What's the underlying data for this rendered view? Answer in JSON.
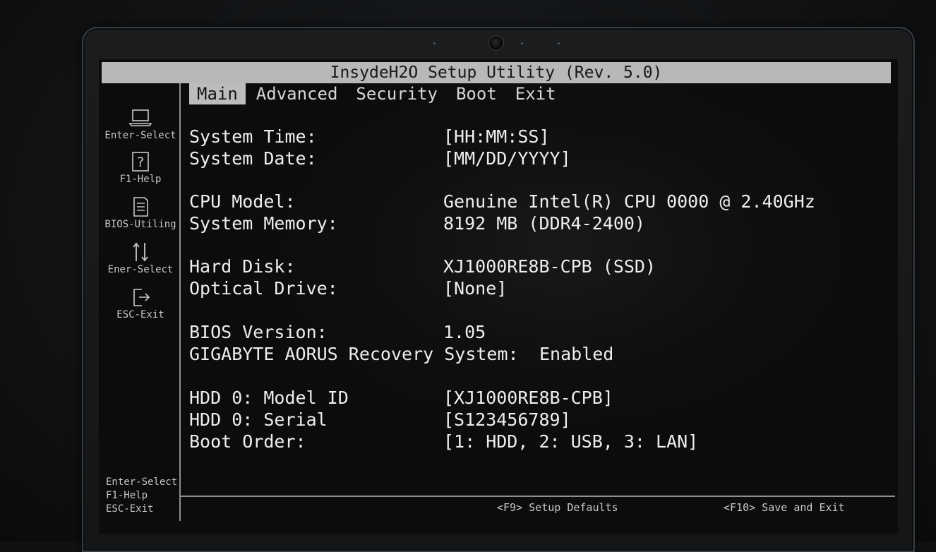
{
  "title": "InsydeH2O Setup Utility (Rev. 5.0)",
  "tabs": [
    {
      "label": "Main",
      "active": true
    },
    {
      "label": "Advanced",
      "active": false
    },
    {
      "label": "Security",
      "active": false
    },
    {
      "label": "Boot",
      "active": false
    },
    {
      "label": "Exit",
      "active": false
    }
  ],
  "sidebar": {
    "items": [
      {
        "icon": "laptop-icon",
        "label": "Enter-Select"
      },
      {
        "icon": "help-icon",
        "label": "F1-Help"
      },
      {
        "icon": "document-icon",
        "label": "BIOS-Utiling"
      },
      {
        "icon": "arrows-icon",
        "label": "Ener-Select"
      },
      {
        "icon": "exit-icon",
        "label": "ESC-Exit"
      }
    ],
    "footer": [
      "Enter-Select",
      "F1-Help",
      "ESC-Exit"
    ]
  },
  "fields": [
    {
      "label": "System Time:",
      "value": "[HH:MM:SS]"
    },
    {
      "label": "System Date:",
      "value": "[MM/DD/YYYY]"
    },
    {
      "label": "CPU Model:",
      "value": "Genuine Intel(R) CPU 0000 @ 2.40GHz"
    },
    {
      "label": "System Memory:",
      "value": "8192 MB (DDR4-2400)"
    },
    {
      "label": "Hard Disk:",
      "value": "XJ1000RE8B-CPB (SSD)"
    },
    {
      "label": "Optical Drive:",
      "value": "[None]"
    },
    {
      "label": "BIOS Version:",
      "value": "1.05"
    },
    {
      "label": "GIGABYTE AORUS Recovery System:",
      "value": "Enabled"
    },
    {
      "label": "HDD 0: Model ID",
      "value": "[XJ1000RE8B-CPB]"
    },
    {
      "label": "HDD 0: Serial",
      "value": "[S123456789]"
    },
    {
      "label": "Boot Order:",
      "value": "[1: HDD, 2: USB, 3: LAN]"
    }
  ],
  "hints": {
    "defaults": "<F9> Setup Defaults",
    "save_exit": "<F10> Save and Exit"
  }
}
